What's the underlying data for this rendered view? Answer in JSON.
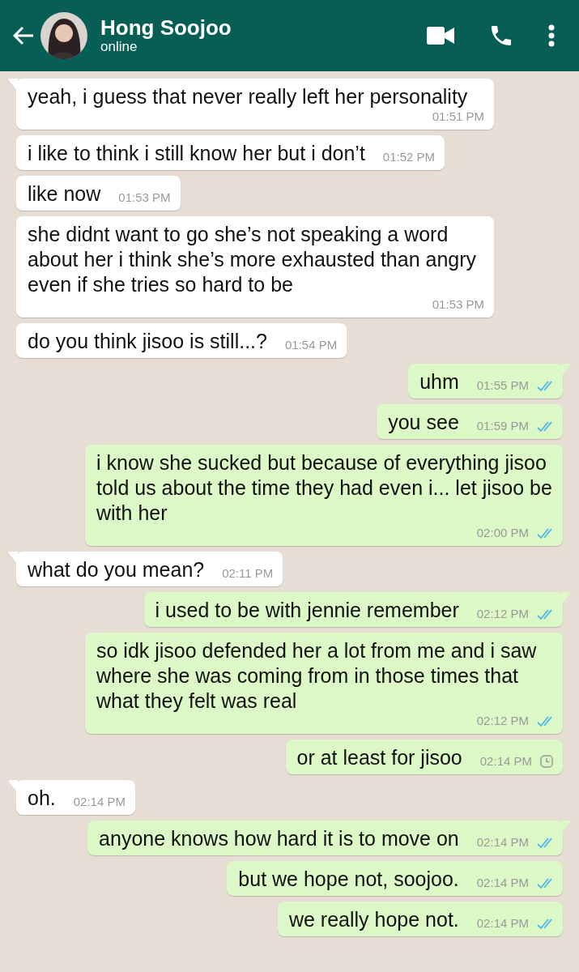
{
  "header": {
    "title": "Hong Soojoo",
    "subtitle": "online"
  },
  "messages": [
    {
      "outgoing": false,
      "tail": true,
      "text": "yeah, i guess that never really left her personality",
      "time": "01:51 PM"
    },
    {
      "outgoing": false,
      "tail": false,
      "text": "i like to think i still know her but i don’t",
      "time": "01:52 PM"
    },
    {
      "outgoing": false,
      "tail": false,
      "text": "like now",
      "time": "01:53 PM"
    },
    {
      "outgoing": false,
      "tail": false,
      "text": "she didnt want to go she’s not speaking a word about her i think she’s more exhausted than angry even if she tries so hard to be",
      "time": "01:53 PM"
    },
    {
      "outgoing": false,
      "tail": false,
      "text": "do you think jisoo is still...?",
      "time": "01:54 PM"
    },
    {
      "outgoing": true,
      "tail": true,
      "text": "uhm",
      "time": "01:55 PM",
      "read": true
    },
    {
      "outgoing": true,
      "tail": false,
      "text": "you see",
      "time": "01:59 PM",
      "read": true
    },
    {
      "outgoing": true,
      "tail": false,
      "text": "i know she sucked but because of everything jisoo told us about the time they had even i... let jisoo be with her",
      "time": "02:00 PM",
      "read": true
    },
    {
      "outgoing": false,
      "tail": true,
      "text": "what do you mean?",
      "time": "02:11 PM"
    },
    {
      "outgoing": true,
      "tail": true,
      "text": "i used to be with jennie remember",
      "time": "02:12 PM",
      "read": true
    },
    {
      "outgoing": true,
      "tail": false,
      "text": "so idk jisoo defended her a lot from me and i saw where she was coming from in those times that what they felt was real",
      "time": "02:12 PM",
      "read": true
    },
    {
      "outgoing": true,
      "tail": false,
      "text": "or at least for jisoo",
      "time": "02:14 PM",
      "read": false
    },
    {
      "outgoing": false,
      "tail": true,
      "text": "oh.",
      "time": "02:14 PM"
    },
    {
      "outgoing": true,
      "tail": true,
      "text": "anyone knows how hard it is to move on",
      "time": "02:14 PM",
      "read": true
    },
    {
      "outgoing": true,
      "tail": false,
      "text": "but we hope not, soojoo.",
      "time": "02:14 PM",
      "read": true
    },
    {
      "outgoing": true,
      "tail": false,
      "text": "we really hope not.",
      "time": "02:14 PM",
      "read": true
    }
  ]
}
